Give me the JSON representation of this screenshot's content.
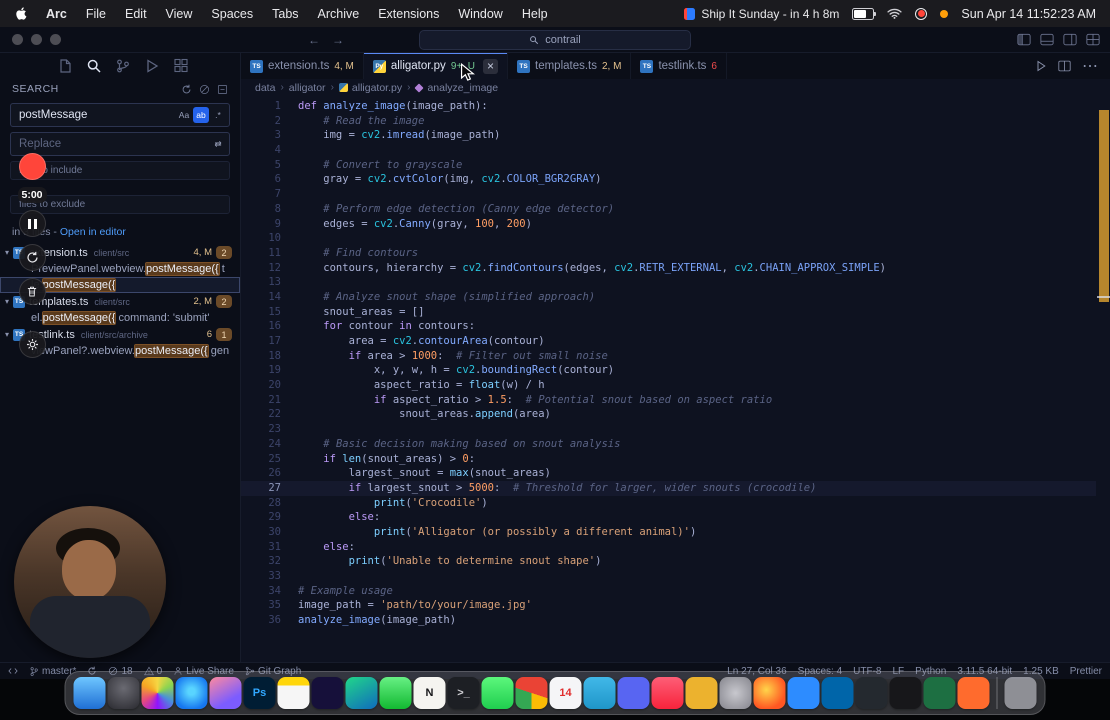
{
  "menubar": {
    "menus": [
      "Arc",
      "File",
      "Edit",
      "View",
      "Spaces",
      "Tabs",
      "Archive",
      "Extensions",
      "Window",
      "Help"
    ],
    "event_label": "Ship It Sunday - in 4 h 8m",
    "clock": "Sun Apr 14 11:52:23 AM"
  },
  "titlebar": {
    "command_center": "contrail"
  },
  "activity": {
    "icons": [
      "explorer",
      "search",
      "source-control",
      "run-debug",
      "extensions"
    ],
    "active": "search"
  },
  "search_panel": {
    "title": "SEARCH",
    "query": "postMessage",
    "replace_placeholder": "Replace",
    "include_placeholder": "files to include",
    "exclude_placeholder": "files to exclude",
    "summary": "in 3 files -",
    "open_in_editor": "Open in editor",
    "results": [
      {
        "type": "file",
        "name": "extension.ts",
        "path": "client/src",
        "badge": "4, M",
        "count": "2"
      },
      {
        "type": "match",
        "before": "PreviewPanel.webview.",
        "match": "postMessage({",
        "after": " t",
        "selected": false
      },
      {
        "type": "match",
        "before": "le.",
        "match": "postMessage({",
        "after": "",
        "selected": true
      },
      {
        "type": "file",
        "name": "templates.ts",
        "path": "client/src",
        "badge": "2, M",
        "count": "2"
      },
      {
        "type": "match",
        "before": "el.",
        "match": "postMessage({",
        "after": " command: 'submit'",
        "selected": false
      },
      {
        "type": "file",
        "name": "testlink.ts",
        "path": "client/src/archive",
        "badge": "6",
        "count": "1"
      },
      {
        "type": "match",
        "before": "viewPanel?.webview.",
        "match": "postMessage({",
        "after": " gen",
        "selected": false
      }
    ]
  },
  "tabs": [
    {
      "label": "extension.ts",
      "icon": "TS",
      "icon_bg": "#2f74c0",
      "badge": "4, M",
      "badge_color": "#e2c08d",
      "active": false
    },
    {
      "label": "alligator.py",
      "icon": "Py",
      "icon_bg": "linear-gradient(135deg,#3776ab 50%,#ffd43b 50%)",
      "badge": "9+, U",
      "badge_color": "#73c991",
      "active": true
    },
    {
      "label": "templates.ts",
      "icon": "TS",
      "icon_bg": "#2f74c0",
      "badge": "2, M",
      "badge_color": "#e2c08d",
      "active": false
    },
    {
      "label": "testlink.ts",
      "icon": "TS",
      "icon_bg": "#2f74c0",
      "badge": "6",
      "badge_color": "#f14c4c",
      "active": false
    }
  ],
  "breadcrumb": [
    {
      "label": "data"
    },
    {
      "label": "alligator"
    },
    {
      "label": "alligator.py",
      "icon": "py"
    },
    {
      "label": "analyze_image",
      "icon": "method"
    }
  ],
  "code": {
    "active_line": 27,
    "lines": [
      "def analyze_image(image_path):",
      "    # Read the image",
      "    img = cv2.imread(image_path)",
      "",
      "    # Convert to grayscale",
      "    gray = cv2.cvtColor(img, cv2.COLOR_BGR2GRAY)",
      "",
      "    # Perform edge detection (Canny edge detector)",
      "    edges = cv2.Canny(gray, 100, 200)",
      "",
      "    # Find contours",
      "    contours, hierarchy = cv2.findContours(edges, cv2.RETR_EXTERNAL, cv2.CHAIN_APPROX_SIMPLE)",
      "",
      "    # Analyze snout shape (simplified approach)",
      "    snout_areas = []",
      "    for contour in contours:",
      "        area = cv2.contourArea(contour)",
      "        if area > 1000:  # Filter out small noise",
      "            x, y, w, h = cv2.boundingRect(contour)",
      "            aspect_ratio = float(w) / h",
      "            if aspect_ratio > 1.5:  # Potential snout based on aspect ratio",
      "                snout_areas.append(area)",
      "",
      "    # Basic decision making based on snout analysis",
      "    if len(snout_areas) > 0:",
      "        largest_snout = max(snout_areas)",
      "        if largest_snout > 5000:  # Threshold for larger, wider snouts (crocodile)",
      "            print('Crocodile')",
      "        else:",
      "            print('Alligator (or possibly a different animal)')",
      "    else:",
      "        print('Unable to determine snout shape')",
      "",
      "# Example usage",
      "image_path = 'path/to/your/image.jpg'",
      "analyze_image(image_path)"
    ]
  },
  "statusbar": {
    "left": [
      {
        "icon": "remote",
        "label": ""
      },
      {
        "icon": "branch",
        "label": "master*"
      },
      {
        "icon": "sync",
        "label": ""
      },
      {
        "icon": "error",
        "label": "18"
      },
      {
        "icon": "warning",
        "label": "0"
      },
      {
        "icon": "live",
        "label": "Live Share"
      },
      {
        "icon": "graph",
        "label": "Git Graph"
      }
    ],
    "right": [
      "Ln 27, Col 36",
      "Spaces: 4",
      "UTF-8",
      "LF",
      "Python",
      "3.11.5 64-bit",
      "1.25 KB",
      "Prettier"
    ]
  },
  "recorder": {
    "time": "5:00"
  },
  "dock": [
    {
      "name": "finder",
      "bg": "linear-gradient(180deg,#6ec6ff,#1f6fd4)"
    },
    {
      "name": "launchpad",
      "bg": "radial-gradient(circle at 50% 35%,#6a6a72,#2a2a30)"
    },
    {
      "name": "photos",
      "bg": "conic-gradient(#f6d743,#8bd450,#4a90d9,#9013fe,#e64980,#f5a623,#f6d743)"
    },
    {
      "name": "safari",
      "bg": "radial-gradient(circle at 50% 45%,#59d4ff 15%,#1677f0 75%)"
    },
    {
      "name": "arc",
      "bg": "linear-gradient(150deg,#ff8a9e,#7c5cff 70%)"
    },
    {
      "name": "photoshop",
      "bg": "#001d34",
      "glyph": "Ps",
      "glyph_color": "#31a8ff"
    },
    {
      "name": "notes",
      "bg": "linear-gradient(180deg,#ffd60a 26%,#f6f6f6 26%)"
    },
    {
      "name": "obsidian",
      "bg": "#16103a"
    },
    {
      "name": "pycharm",
      "bg": "linear-gradient(150deg,#21d789,#0f6bbd)"
    },
    {
      "name": "facetime",
      "bg": "linear-gradient(180deg,#67f084,#12b931)"
    },
    {
      "name": "notion",
      "bg": "#f5f4f0",
      "glyph": "N",
      "glyph_color": "#17171a"
    },
    {
      "name": "terminal",
      "bg": "#1d1f24",
      "glyph": ">_",
      "glyph_color": "#d0d0d4"
    },
    {
      "name": "whatsapp",
      "bg": "linear-gradient(180deg,#5cf77c,#1fce4f)"
    },
    {
      "name": "chrome",
      "bg": "conic-gradient(#ea4335 0 30%,#fbbc05 30% 50%,#34a853 50% 80%,#ea4335 80%)"
    },
    {
      "name": "calendar",
      "bg": "#f5f5f7",
      "glyph": "14",
      "glyph_color": "#e02d2d"
    },
    {
      "name": "telegram",
      "bg": "linear-gradient(180deg,#41b8e8,#1f96c9)"
    },
    {
      "name": "discord",
      "bg": "#5865f2"
    },
    {
      "name": "music",
      "bg": "linear-gradient(180deg,#fd5e77,#f8233b)"
    },
    {
      "name": "slack",
      "bg": "#ecb22e"
    },
    {
      "name": "system-settings",
      "bg": "radial-gradient(circle,#c8c8ce,#85858d)"
    },
    {
      "name": "firefox",
      "bg": "radial-gradient(circle at 40% 40%,#ffd54a,#ff5722 70%)"
    },
    {
      "name": "zoom",
      "bg": "#2d8cff"
    },
    {
      "name": "vscode",
      "bg": "#0065a9"
    },
    {
      "name": "github",
      "bg": "#24292f"
    },
    {
      "name": "tv",
      "bg": "#17171a"
    },
    {
      "name": "excel",
      "bg": "#1d6f42"
    },
    {
      "name": "davinci",
      "bg": "#ff6b2d"
    },
    {
      "name": "trash",
      "bg": "rgba(220,220,228,0.55)",
      "divider_before": true
    }
  ]
}
